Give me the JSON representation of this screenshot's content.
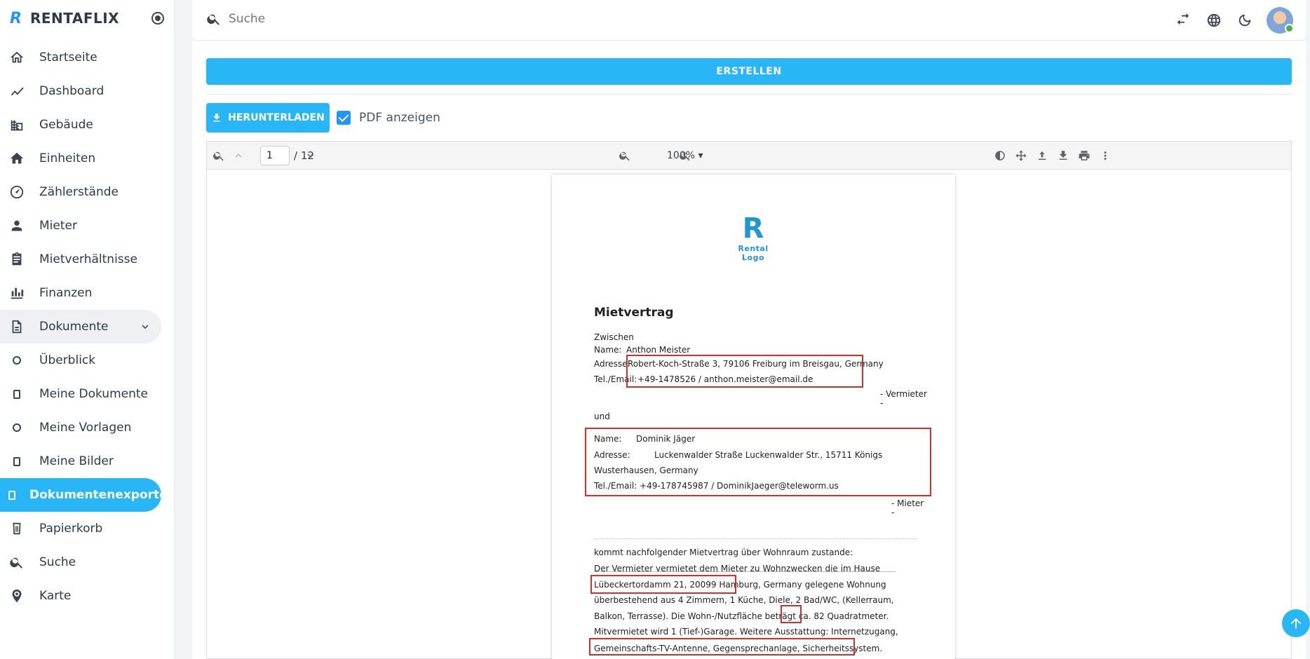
{
  "brand": {
    "logo": "R",
    "name": "RENTAFLIX"
  },
  "sidebar": {
    "items": [
      {
        "label": "Startseite",
        "icon": "home-outline-icon"
      },
      {
        "label": "Dashboard",
        "icon": "chart-line-icon"
      },
      {
        "label": "Gebäude",
        "icon": "buildings-icon"
      },
      {
        "label": "Einheiten",
        "icon": "house-icon"
      },
      {
        "label": "Zählerstände",
        "icon": "gauge-icon"
      },
      {
        "label": "Mieter",
        "icon": "person-icon"
      },
      {
        "label": "Mietverhältnisse",
        "icon": "clipboard-icon"
      },
      {
        "label": "Finanzen",
        "icon": "finance-icon"
      },
      {
        "label": "Dokumente",
        "icon": "document-icon"
      },
      {
        "label": "Überblick",
        "icon": "circle-icon"
      },
      {
        "label": "Meine Dokumente",
        "icon": "file-icon"
      },
      {
        "label": "Meine Vorlagen",
        "icon": "circle-icon"
      },
      {
        "label": "Meine Bilder",
        "icon": "file-icon"
      },
      {
        "label": "Dokumentenexporte",
        "icon": "file-icon"
      },
      {
        "label": "Papierkorb",
        "icon": "trash-icon"
      },
      {
        "label": "Suche",
        "icon": "search-icon"
      },
      {
        "label": "Karte",
        "icon": "map-pin-icon"
      }
    ]
  },
  "topbar": {
    "search_placeholder": "Suche"
  },
  "main": {
    "create_label": "ERSTELLEN",
    "download_label": "HERUNTERLADEN",
    "show_pdf_label": "PDF anzeigen",
    "show_pdf_checked": true
  },
  "viewer": {
    "current_page": "1",
    "total_pages": "/ 12",
    "zoom": "100% ▾"
  },
  "document": {
    "logo_letter": "R",
    "logo_text": "Rental Logo",
    "title": "Mietvertrag",
    "zwischen": "Zwischen",
    "landlord": {
      "name_label": "Name:",
      "name": "Anthon Meister",
      "address_label": "Adresse:",
      "address": "Robert-Koch-Straße 3, 79106 Freiburg im Breisgau, Germany",
      "contact_label": "Tel./Email:",
      "contact": "+49-1478526 / anthon.meister@email.de",
      "role": "-  Vermieter",
      "role_dash": "-"
    },
    "und": "und",
    "tenant": {
      "name_label": "Name:",
      "name": "Dominik Jäger",
      "address_label": "Adresse:",
      "address_line1": "Luckenwalder  Straße  Luckenwalder  Str.,  15711  Königs",
      "address_line2": "Wusterhausen, Germany",
      "contact": "Tel./Email: +49-178745987 / DominikJaeger@teleworm.us",
      "role": "-   Mieter",
      "role_dash": "-"
    },
    "lines": [
      "kommt nachfolgender Mietvertrag über Wohnraum zustande:",
      "Der Vermieter vermietet dem Mieter zu Wohnzwecken die im Hause",
      "Lübeckertordamm 21, 20099 Hamburg, Germany gelegene Wohnung",
      "überbestehend aus  4  Zimmern, 1 Küche, Diele, 2 Bad/WC, (Kellerraum,",
      "Balkon, Terrasse). Die Wohn-/Nutzfläche beträgt ca.  82  Quadratmeter.",
      "Mitvermietet wird 1 (Tief-)Garage. Weitere Ausstattung: Internetzugang,",
      "Gemeinschafts-TV-Antenne, Gegensprechanlage, Sicherheitssystem."
    ]
  }
}
